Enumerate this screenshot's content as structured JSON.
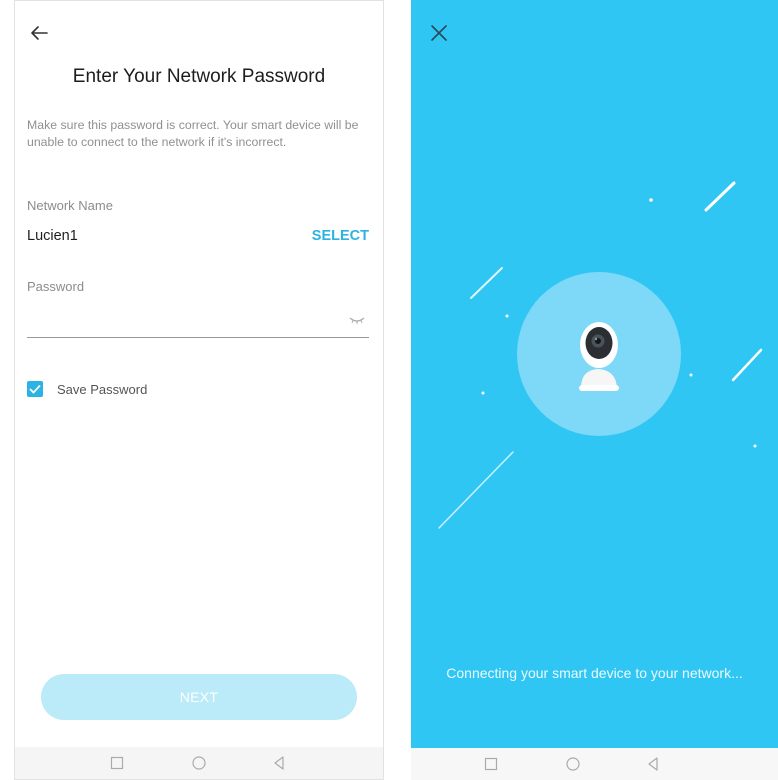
{
  "left_screen": {
    "title": "Enter Your Network Password",
    "description": "Make sure this password is correct. Your smart device will be unable to connect to the network if it's incorrect.",
    "network_name_label": "Network Name",
    "network_name_value": "Lucien1",
    "select_label": "SELECT",
    "password_label": "Password",
    "password_value": "",
    "save_password_label": "Save Password",
    "save_password_checked": true,
    "next_label": "NEXT"
  },
  "right_screen": {
    "status_text": "Connecting your smart device to your network..."
  },
  "colors": {
    "accent": "#2bb3e3",
    "connecting_background": "#30c6f4",
    "next_button_disabled": "#bbeaf8"
  },
  "icons": {
    "back": "arrow-left-icon",
    "close": "close-icon",
    "password_visibility": "eye-closed-icon",
    "device": "camera-icon",
    "nav": [
      "square-icon",
      "circle-icon",
      "triangle-left-icon"
    ]
  }
}
